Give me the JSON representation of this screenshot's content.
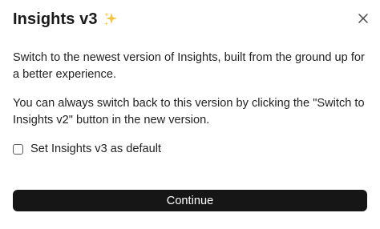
{
  "dialog": {
    "title": "Insights v3",
    "title_emoji": "sparkles-icon",
    "close_icon": "close-icon",
    "paragraph1": "Switch to the newest version of Insights, built from the ground up for a better experience.",
    "paragraph2": "You can always switch back to this version by clicking the \"Switch to Insights v2\" button in the new version.",
    "checkbox_label": "Set Insights v3 as default",
    "checkbox_checked": false,
    "continue_label": "Continue"
  },
  "colors": {
    "button_bg": "#161616",
    "button_text": "#ffffff",
    "sparkle": "#f5c542"
  }
}
